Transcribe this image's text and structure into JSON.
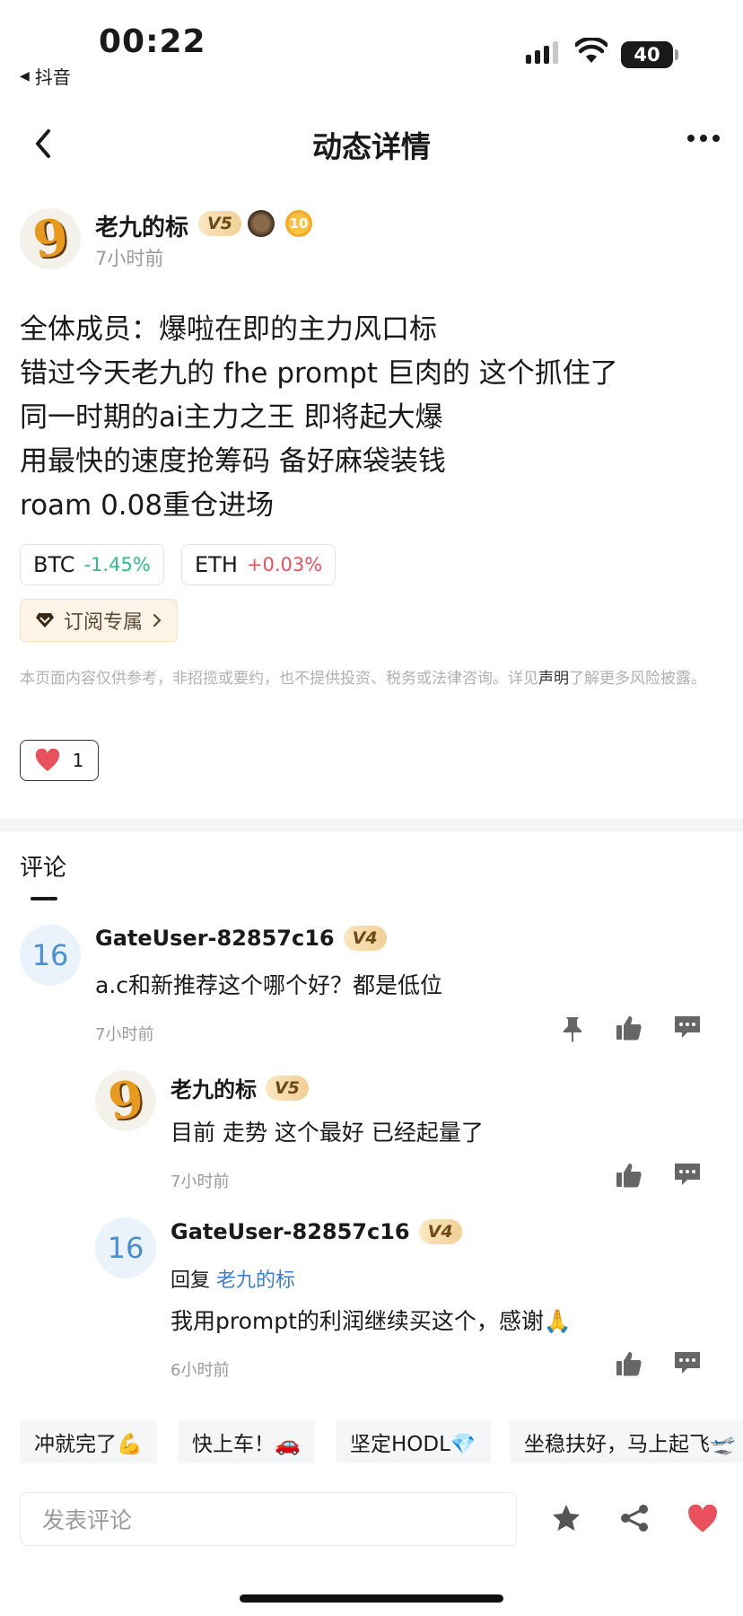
{
  "status_bar": {
    "time": "00:22",
    "back_app": "抖音",
    "battery": "40"
  },
  "nav": {
    "title": "动态详情"
  },
  "post": {
    "author": "老九的标",
    "level": "V5",
    "medal_number": "10",
    "time": "7小时前",
    "lines": [
      "全体成员：爆啦在即的主力风口标",
      "错过今天老九的 fhe prompt 巨肉的 这个抓住了",
      "同一时期的ai主力之王 即将起大爆",
      "用最快的速度抢筹码 备好麻袋装钱",
      "roam 0.08重仓进场"
    ],
    "coins": [
      {
        "symbol": "BTC",
        "change": "-1.45%"
      },
      {
        "symbol": "ETH",
        "change": "+0.03%"
      }
    ],
    "subscribe_label": "订阅专属",
    "disclaimer_pre": "本页面内容仅供参考，非招揽或要约，也不提供投资、税务或法律咨询。详见",
    "disclaimer_link": "声明",
    "disclaimer_post": "了解更多风险披露。",
    "like_count": "1"
  },
  "comments_section": {
    "title": "评论",
    "comments": [
      {
        "avatar": "16",
        "name": "GateUser-82857c16",
        "level": "V4",
        "text": "a.c和新推荐这个哪个好？都是低位",
        "time": "7小时前"
      },
      {
        "avatar": "9",
        "name": "老九的标",
        "level": "V5",
        "text": "目前 走势 这个最好 已经起量了",
        "time": "7小时前"
      },
      {
        "avatar": "16",
        "name": "GateUser-82857c16",
        "level": "V4",
        "reply_prefix": "回复",
        "reply_to": "老九的标",
        "text": "我用prompt的利润继续买这个，感谢🙏",
        "time": "6小时前"
      }
    ]
  },
  "quick_replies": [
    "冲就完了💪",
    "快上车！🚗",
    "坚定HODL💎",
    "坐稳扶好，马上起飞🛫"
  ],
  "comment_input": {
    "placeholder": "发表评论"
  },
  "colors": {
    "down": "#2dbd85",
    "up": "#e8505b",
    "link": "#3b7ed0",
    "heart": "#e8505b"
  }
}
